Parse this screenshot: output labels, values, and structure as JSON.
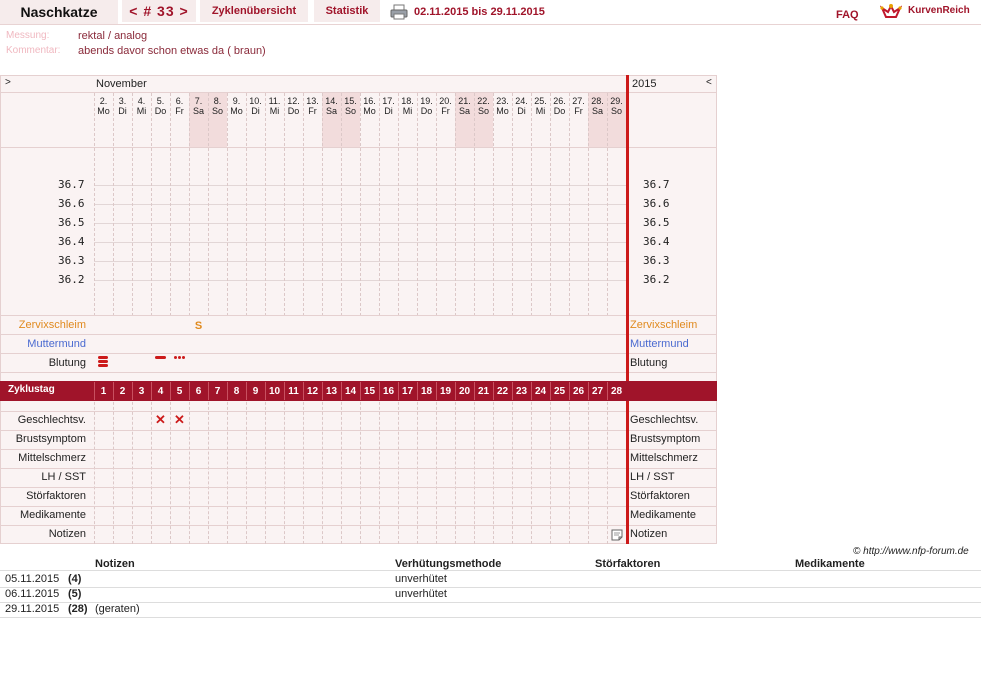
{
  "header": {
    "app_title": "Naschkatze",
    "cycle_label": "< # 33 >",
    "tab_cycles": "Zyklenübersicht",
    "tab_stats": "Statistik",
    "date_range": "02.11.2015 bis 29.11.2015",
    "faq": "FAQ",
    "logo": "KurvenReich"
  },
  "meta": {
    "measure_label": "Messung:",
    "measure_value": "rektal / analog",
    "comment_label": "Kommentar:",
    "comment_value": "abends davor schon etwas da ( braun)"
  },
  "chart": {
    "nav_left": ">",
    "nav_right": "<",
    "month": "November",
    "year": "2015",
    "days": [
      {
        "d": "2.",
        "w": "Mo",
        "we": false
      },
      {
        "d": "3.",
        "w": "Di",
        "we": false
      },
      {
        "d": "4.",
        "w": "Mi",
        "we": false
      },
      {
        "d": "5.",
        "w": "Do",
        "we": false
      },
      {
        "d": "6.",
        "w": "Fr",
        "we": false
      },
      {
        "d": "7.",
        "w": "Sa",
        "we": true
      },
      {
        "d": "8.",
        "w": "So",
        "we": true
      },
      {
        "d": "9.",
        "w": "Mo",
        "we": false
      },
      {
        "d": "10.",
        "w": "Di",
        "we": false
      },
      {
        "d": "11.",
        "w": "Mi",
        "we": false
      },
      {
        "d": "12.",
        "w": "Do",
        "we": false
      },
      {
        "d": "13.",
        "w": "Fr",
        "we": false
      },
      {
        "d": "14.",
        "w": "Sa",
        "we": true
      },
      {
        "d": "15.",
        "w": "So",
        "we": true
      },
      {
        "d": "16.",
        "w": "Mo",
        "we": false
      },
      {
        "d": "17.",
        "w": "Di",
        "we": false
      },
      {
        "d": "18.",
        "w": "Mi",
        "we": false
      },
      {
        "d": "19.",
        "w": "Do",
        "we": false
      },
      {
        "d": "20.",
        "w": "Fr",
        "we": false
      },
      {
        "d": "21.",
        "w": "Sa",
        "we": true
      },
      {
        "d": "22.",
        "w": "So",
        "we": true
      },
      {
        "d": "23.",
        "w": "Mo",
        "we": false
      },
      {
        "d": "24.",
        "w": "Di",
        "we": false
      },
      {
        "d": "25.",
        "w": "Mi",
        "we": false
      },
      {
        "d": "26.",
        "w": "Do",
        "we": false
      },
      {
        "d": "27.",
        "w": "Fr",
        "we": false
      },
      {
        "d": "28.",
        "w": "Sa",
        "we": true
      },
      {
        "d": "29.",
        "w": "So",
        "we": true
      }
    ],
    "temp_ticks": [
      "36.7",
      "36.6",
      "36.5",
      "36.4",
      "36.3",
      "36.2"
    ],
    "rows_top": {
      "cervix": "Zervixschleim",
      "cervix_color": "#e08a1e",
      "os": "Muttermund",
      "os_color": "#4a6ad0",
      "bleeding": "Blutung"
    },
    "cycle_row_label": "Zyklustag",
    "cycle_days": [
      "1",
      "2",
      "3",
      "4",
      "5",
      "6",
      "7",
      "8",
      "9",
      "10",
      "11",
      "12",
      "13",
      "14",
      "15",
      "16",
      "17",
      "18",
      "19",
      "20",
      "21",
      "22",
      "23",
      "24",
      "25",
      "26",
      "27",
      "28"
    ],
    "rows_bottom": [
      "Geschlechtsv.",
      "Brustsymptom",
      "Mittelschmerz",
      "LH / SST",
      "Störfaktoren",
      "Medikamente",
      "Notizen"
    ],
    "cervix_mark": {
      "cycle_day": 6,
      "value": "S"
    },
    "bleeding_marks": [
      {
        "cycle_day": 1,
        "level": "heavy"
      },
      {
        "cycle_day": 4,
        "level": "light"
      },
      {
        "cycle_day": 5,
        "level": "spotting"
      }
    ],
    "intercourse_days": [
      4,
      5
    ],
    "notes_day": 28,
    "accent": "#a0142a",
    "weekend_color": "#f2dcdc"
  },
  "copyright": "© http://www.nfp-forum.de",
  "table": {
    "headers": {
      "notes": "Notizen",
      "method": "Verhütungsmethode",
      "disturb": "Störfaktoren",
      "meds": "Medikamente"
    },
    "rows": [
      {
        "date": "05.11.2015",
        "day": "(4)",
        "note": "",
        "method": "unverhütet"
      },
      {
        "date": "06.11.2015",
        "day": "(5)",
        "note": "",
        "method": "unverhütet"
      },
      {
        "date": "29.11.2015",
        "day": "(28)",
        "note": "(geraten)",
        "method": ""
      }
    ]
  }
}
